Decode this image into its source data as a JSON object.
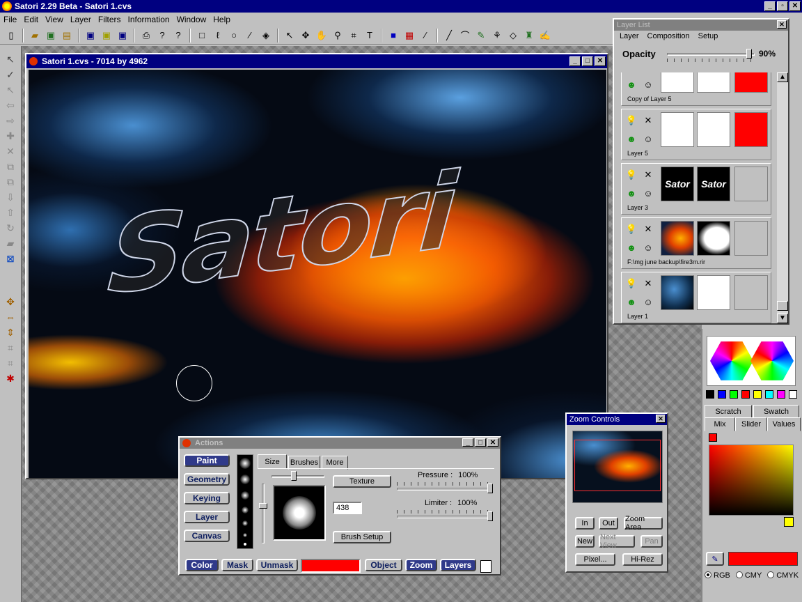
{
  "app": {
    "title": "Satori 2.29 Beta - Satori 1.cvs",
    "controls": {
      "minimize": "_",
      "maximize": "▫",
      "close": "✕"
    }
  },
  "menu": [
    "File",
    "Edit",
    "View",
    "Layer",
    "Filters",
    "Information",
    "Window",
    "Help"
  ],
  "toolbar_icons": [
    "new-icon",
    "open-icon",
    "save-icon",
    "print-icon",
    "help-icon",
    "rect-select-icon",
    "lasso-icon",
    "ellipse-icon",
    "wand-icon",
    "fill-icon",
    "arrow-icon",
    "move-icon",
    "hand-icon",
    "zoom-icon",
    "crop-icon",
    "text-icon",
    "color-icon",
    "brush-icon",
    "eraser-icon",
    "stamp-icon"
  ],
  "document": {
    "title": "Satori 1.cvs - 7014 by 4962",
    "canvas_text": "Satori"
  },
  "layer_list": {
    "title": "Layer List",
    "menu": [
      "Layer",
      "Composition",
      "Setup"
    ],
    "opacity_label": "Opacity",
    "opacity_value": "90%",
    "opacity_level": 0.9,
    "layers": [
      {
        "name": "Copy of Layer 5"
      },
      {
        "name": "Layer 5"
      },
      {
        "name": "Layer 3",
        "thumb_text": "Sator"
      },
      {
        "name": "F:\\mg june backup\\fire3m.rir"
      },
      {
        "name": "Layer 1"
      }
    ]
  },
  "color_panel": {
    "tabs_top": [
      "Scratch",
      "Swatch"
    ],
    "tabs_bottom": [
      "Mix",
      "Slider",
      "Values"
    ],
    "swatches": [
      "#000000",
      "#0000ff",
      "#00ff00",
      "#ff0000",
      "#ffff00",
      "#00ffff",
      "#ff00ff",
      "#ffffff"
    ],
    "current_color": "#ff0000",
    "modes": [
      "RGB",
      "CMY",
      "CMYK"
    ],
    "selected_mode": "RGB"
  },
  "zoom_controls": {
    "title": "Zoom Controls",
    "buttons": [
      "In",
      "Out",
      "Zoom Area",
      "New",
      "Next View",
      "Pan",
      "Pixel...",
      "Hi-Rez"
    ]
  },
  "actions": {
    "title": "Actions",
    "modes": [
      "Paint",
      "Geometry",
      "Keying",
      "Layer",
      "Canvas"
    ],
    "tabs": [
      "Size",
      "Brushes",
      "More"
    ],
    "texture_label": "Texture",
    "pressure_label": "Pressure :",
    "pressure_value": "100%",
    "limiter_label": "Limiter :",
    "limiter_value": "100%",
    "size_value": "438",
    "brush_setup_label": "Brush Setup",
    "bottom": [
      "Color",
      "Mask",
      "Unmask",
      "Object",
      "Zoom",
      "Layers"
    ],
    "color_swatch": "#ff0000"
  }
}
